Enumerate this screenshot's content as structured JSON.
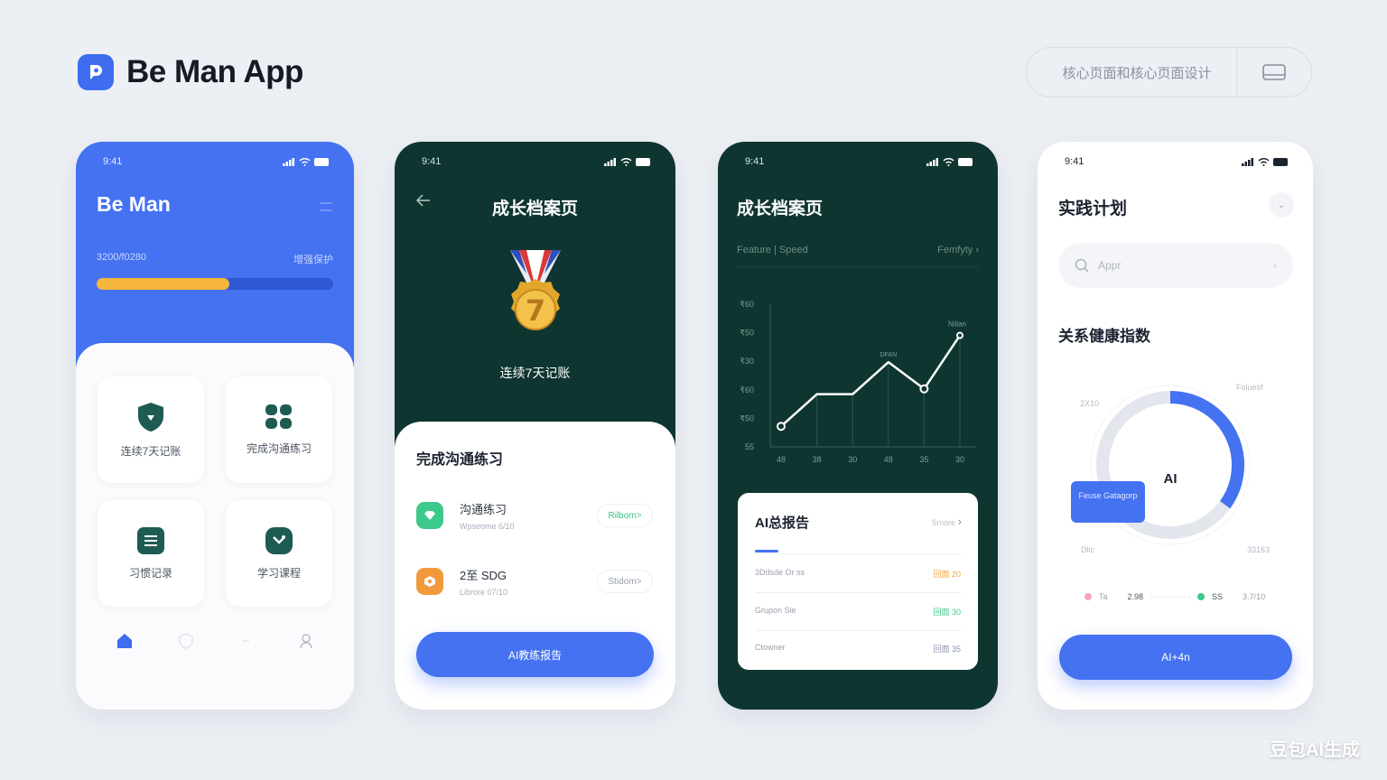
{
  "brand": {
    "title": "Be Man App"
  },
  "header": {
    "pill_text": "核心页面和核心页面设计"
  },
  "status_time": "9:41",
  "p1": {
    "title": "Be Man",
    "meta_left": "3200/f0280",
    "meta_right": "增强保护",
    "progress": 0.56,
    "tiles": [
      {
        "label": "连续7天记账",
        "icon": "shield-icon"
      },
      {
        "label": "完成沟通练习",
        "icon": "grid-icon"
      },
      {
        "label": "习惯记录",
        "icon": "list-icon"
      },
      {
        "label": "学习课程",
        "icon": "chat-icon"
      }
    ],
    "nav": [
      "home-icon",
      "shield-icon",
      "dot-icon",
      "profile-icon"
    ]
  },
  "p2": {
    "title": "成长档案页",
    "medal_number": "7",
    "medal_label": "连续7天记账",
    "sheet_title": "完成沟通练习",
    "rows": [
      {
        "main": "沟通练习",
        "sub": "Wpseome   6/10",
        "pill": "Rilbom>",
        "color": "#3cc98a",
        "pill_color": "#3cc98a"
      },
      {
        "main": "2至 SDG",
        "sub": "Librore   07/10",
        "pill": "Stidom>",
        "color": "#f29a3b",
        "pill_color": "#9aa0aa"
      }
    ],
    "cta": "AI教练报告"
  },
  "p3": {
    "title": "成长档案页",
    "filter_left": "Feature | Speed",
    "filter_right": "Femfyty ›",
    "chart_data": {
      "type": "line",
      "categories": [
        "48",
        "38",
        "30",
        "48",
        "35",
        "30"
      ],
      "y_ticks": [
        "₹60",
        "₹50",
        "₹30",
        "₹60",
        "₹50",
        "55"
      ],
      "series": [
        {
          "values": [
            0.1,
            0.34,
            0.34,
            0.58,
            0.38,
            0.78
          ]
        }
      ],
      "annotations": [
        "DFAN",
        "Nilian"
      ]
    },
    "card": {
      "title": "AI总报告",
      "more": "Smore",
      "stats": [
        {
          "label": "3Ddsde Or ss",
          "value": "回面 20",
          "color": "#f2a444"
        },
        {
          "label": "Grupon Sie",
          "value": "回面 30",
          "color": "#3cc98a"
        },
        {
          "label": "Ctowner",
          "value": "回面 35",
          "color": "#8a93a8"
        }
      ]
    }
  },
  "p4": {
    "title": "实践计划",
    "search_placeholder": "Appr",
    "subtitle": "关系健康指数",
    "donut": {
      "center": "AI",
      "labels": [
        "2X10",
        "Foluesf",
        "Dlic",
        "33163"
      ],
      "value": 0.35,
      "tag": "Feuse Gatagorp"
    },
    "legend": [
      {
        "name": "Ta",
        "value": "2.98",
        "color": "#f4a7c0"
      },
      {
        "name": "SS",
        "value": "3.7/10",
        "color": "#3cc98a"
      }
    ],
    "cta": "AI+4n"
  },
  "watermark": "豆包AI生成"
}
